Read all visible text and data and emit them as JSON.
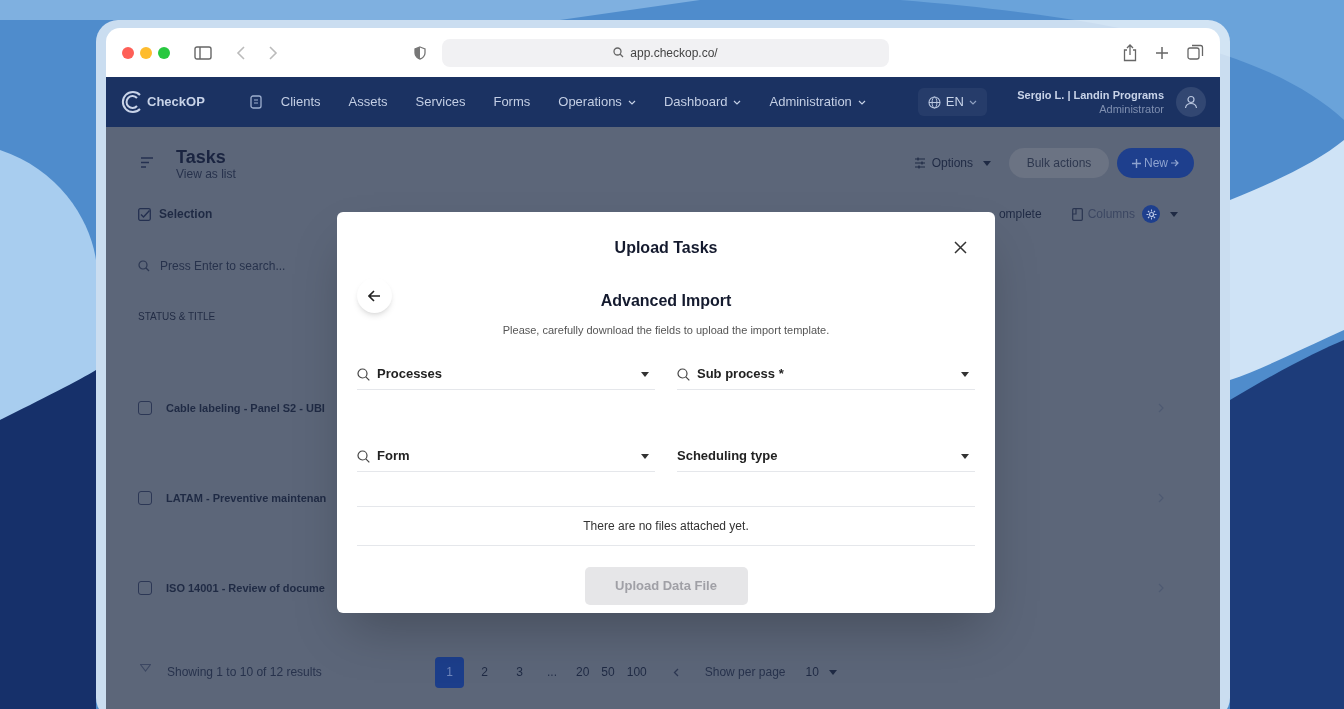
{
  "browser": {
    "url": "app.checkop.co/"
  },
  "nav": {
    "brand": "CheckOP",
    "items": [
      {
        "label": "Clients",
        "dropdown": false
      },
      {
        "label": "Assets",
        "dropdown": false
      },
      {
        "label": "Services",
        "dropdown": false
      },
      {
        "label": "Forms",
        "dropdown": false
      },
      {
        "label": "Operations",
        "dropdown": true
      },
      {
        "label": "Dashboard",
        "dropdown": true
      },
      {
        "label": "Administration",
        "dropdown": true
      }
    ],
    "language": "EN",
    "user": {
      "name": "Sergio L. | Landin Programs",
      "role": "Administrator"
    }
  },
  "page": {
    "title": "Tasks",
    "subtitle": "View as list",
    "options": "Options",
    "bulk_actions": {
      "label": "Bulk actions",
      "disabled": true
    },
    "new_button": "New"
  },
  "toolbar": {
    "selection": "Selection",
    "complete": "omplete",
    "columns": "Columns"
  },
  "search": {
    "placeholder": "Press Enter to search..."
  },
  "table": {
    "columns": [
      "STATUS & TITLE"
    ],
    "rows": [
      {
        "title": "Cable labeling - Panel S2 - UBI",
        "checked": false
      },
      {
        "title": "LATAM - Preventive maintenan",
        "checked": false
      },
      {
        "title": "ISO 14001 - Review of docume",
        "checked": false
      }
    ]
  },
  "pagination": {
    "summary": "Showing 1 to 10 of 12 results",
    "pages": [
      {
        "label": "1",
        "selected": true
      },
      {
        "label": "2",
        "selected": false
      },
      {
        "label": "3",
        "selected": false
      }
    ],
    "ellipsis": "...",
    "sizes": [
      "20",
      "50",
      "100"
    ],
    "per_page_label": "Show per page",
    "per_page": "10"
  },
  "modal": {
    "title": "Upload Tasks",
    "heading": "Advanced Import",
    "description": "Please, carefully download the fields to upload the import template.",
    "fields": [
      {
        "label": "Processes",
        "searchable": true
      },
      {
        "label": "Sub process *",
        "searchable": true
      },
      {
        "label": "Form",
        "searchable": true
      },
      {
        "label": "Scheduling type",
        "searchable": false
      }
    ],
    "empty_message": "There are no files attached yet.",
    "upload_button": {
      "label": "Upload Data File",
      "disabled": true
    }
  }
}
